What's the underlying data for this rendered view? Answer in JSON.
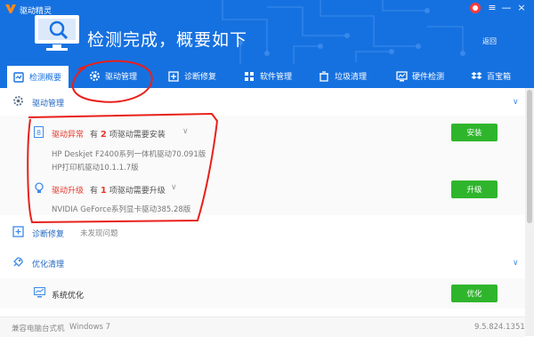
{
  "window": {
    "title": "驱动精灵",
    "minimize": "—",
    "close": "×"
  },
  "header": {
    "status_title": "检测完成，概要如下",
    "back_label": "返回"
  },
  "tabs": [
    {
      "label": "检测概要",
      "icon": "home-icon",
      "active": true
    },
    {
      "label": "驱动管理",
      "icon": "gear-icon",
      "active": false
    },
    {
      "label": "诊断修复",
      "icon": "repair-icon",
      "active": false
    },
    {
      "label": "软件管理",
      "icon": "software-icon",
      "active": false
    },
    {
      "label": "垃圾清理",
      "icon": "trash-icon",
      "active": false
    },
    {
      "label": "硬件检测",
      "icon": "hardware-icon",
      "active": false
    },
    {
      "label": "百宝箱",
      "icon": "dropbox-icon",
      "active": false
    }
  ],
  "sections": {
    "driver_mgmt": {
      "label": "驱动管理",
      "abnormal": {
        "label": "驱动异常",
        "prefix": "有",
        "count": "2",
        "suffix": "项驱动需要安装",
        "items": [
          "HP Deskjet F2400系列一体机驱动70.091版",
          "HP打印机驱动10.1.1.7版"
        ],
        "button": "安装"
      },
      "upgrade": {
        "label": "驱动升级",
        "prefix": "有",
        "count": "1",
        "suffix": "项驱动需要升级",
        "items": [
          "NVIDIA GeForce系列显卡驱动385.28版"
        ],
        "button": "升级"
      }
    },
    "diagnose": {
      "label": "诊断修复",
      "status": "未发现问题"
    },
    "optimize": {
      "label": "优化清理",
      "item_label": "系统优化",
      "button": "优化"
    }
  },
  "footer": {
    "machine": "兼容电脑台式机",
    "os": "Windows 7",
    "version": "9.5.824.1351"
  },
  "colors": {
    "brand_blue": "#1671e0",
    "warning_red": "#e53b2c",
    "action_green": "#2fb52c",
    "annotation_red": "#e8201a"
  }
}
